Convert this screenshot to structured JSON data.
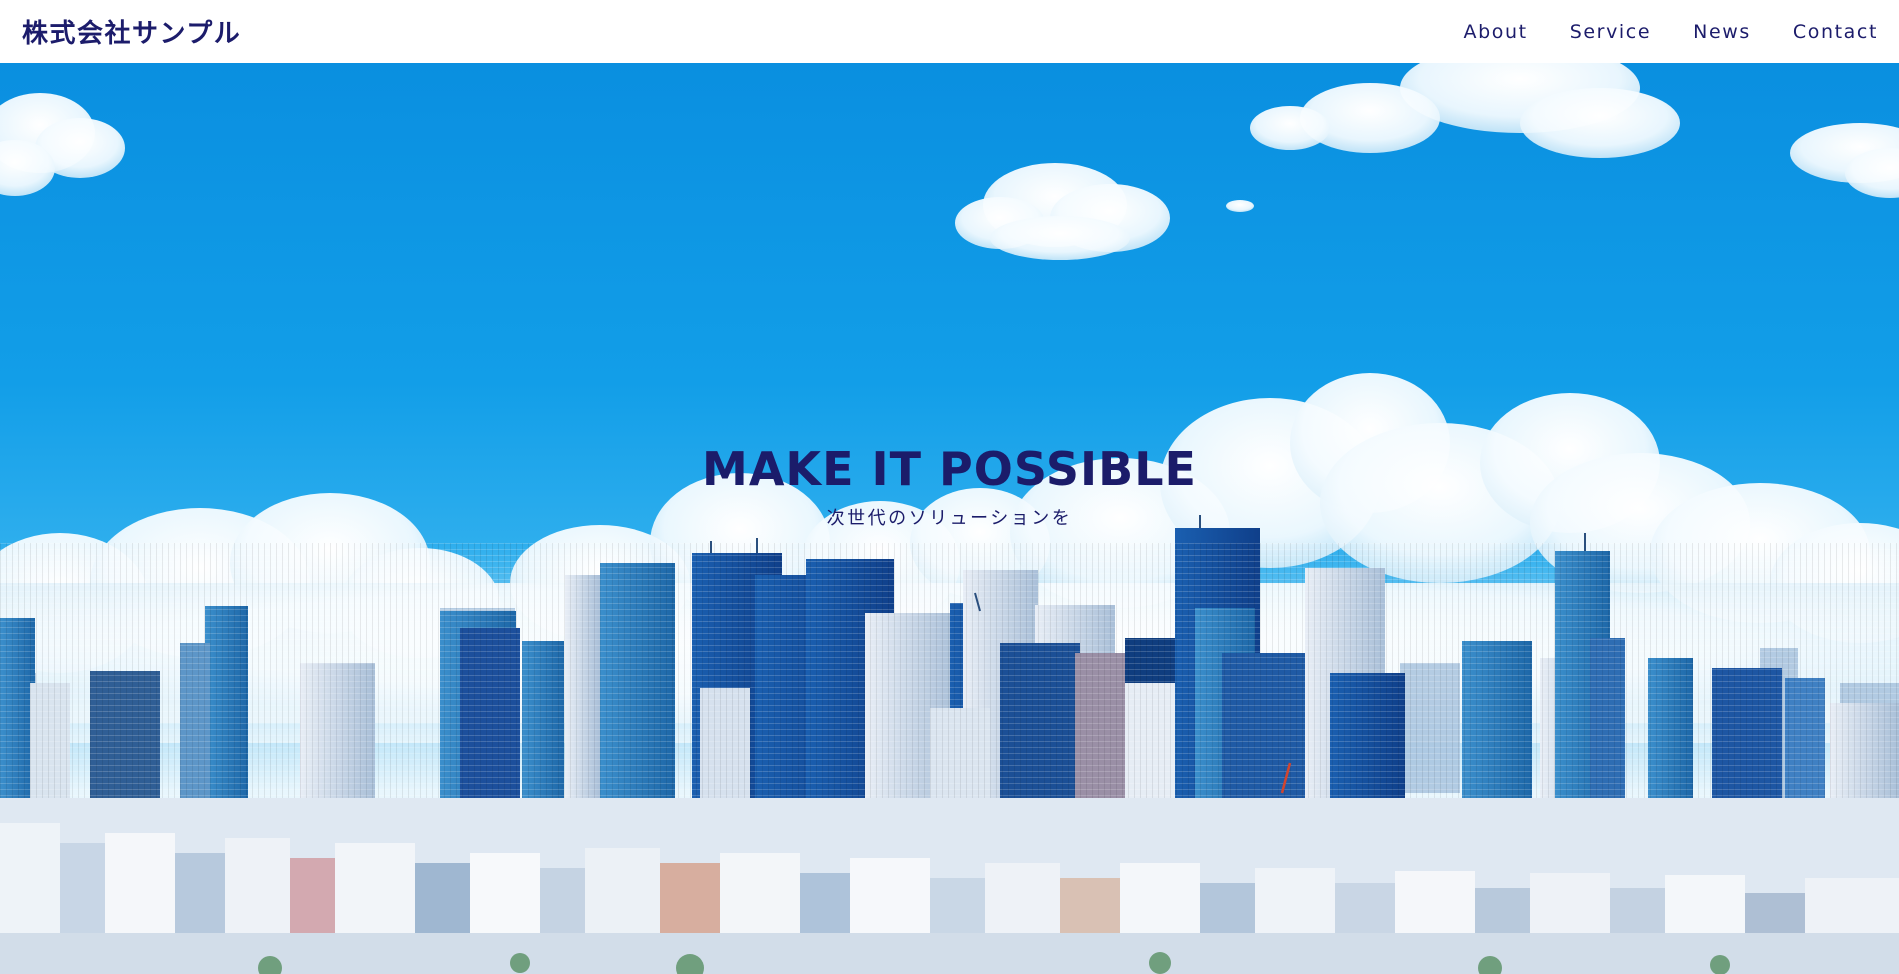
{
  "header": {
    "logo": "株式会社サンプル",
    "nav": [
      {
        "label": "About"
      },
      {
        "label": "Service"
      },
      {
        "label": "News"
      },
      {
        "label": "Contact"
      }
    ]
  },
  "hero": {
    "title": "MAKE IT POSSIBLE",
    "subtitle": "次世代のソリューションを"
  },
  "colors": {
    "brand_text": "#1c1c6b",
    "header_bg": "#ffffff",
    "sky": "#129ee8"
  }
}
